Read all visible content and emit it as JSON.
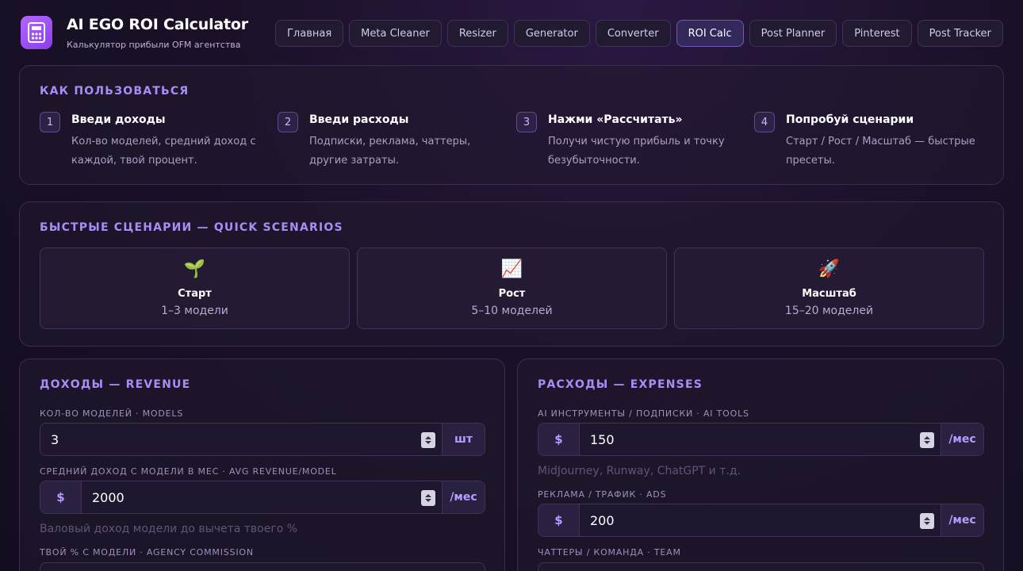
{
  "app": {
    "title": "AI EGO ROI Calculator",
    "subtitle": "Калькулятор прибыли OFM агентства",
    "logo_icon": "calculator-icon"
  },
  "nav": {
    "items": [
      {
        "label": "Главная",
        "active": false
      },
      {
        "label": "Meta Cleaner",
        "active": false
      },
      {
        "label": "Resizer",
        "active": false
      },
      {
        "label": "Generator",
        "active": false
      },
      {
        "label": "Converter",
        "active": false
      },
      {
        "label": "ROI Calc",
        "active": true
      },
      {
        "label": "Post Planner",
        "active": false
      },
      {
        "label": "Pinterest",
        "active": false
      },
      {
        "label": "Post Tracker",
        "active": false
      }
    ]
  },
  "howto": {
    "title": "КАК ПОЛЬЗОВАТЬСЯ",
    "steps": [
      {
        "num": "1",
        "title": "Введи доходы",
        "desc": "Кол-во моделей, средний доход с каждой, твой процент."
      },
      {
        "num": "2",
        "title": "Введи расходы",
        "desc": "Подписки, реклама, чаттеры, другие затраты."
      },
      {
        "num": "3",
        "title": "Нажми «Рассчитать»",
        "desc": "Получи чистую прибыль и точку безубыточности."
      },
      {
        "num": "4",
        "title": "Попробуй сценарии",
        "desc": "Старт / Рост / Масштаб — быстрые пресеты."
      }
    ]
  },
  "scenarios": {
    "title": "БЫСТРЫЕ СЦЕНАРИИ — QUICK SCENARIOS",
    "items": [
      {
        "icon": "🌱",
        "icon_name": "seedling-icon",
        "name": "Старт",
        "desc": "1–3 модели"
      },
      {
        "icon": "📈",
        "icon_name": "chart-up-icon",
        "name": "Рост",
        "desc": "5–10 моделей"
      },
      {
        "icon": "🚀",
        "icon_name": "rocket-icon",
        "name": "Масштаб",
        "desc": "15–20 моделей"
      }
    ]
  },
  "revenue": {
    "title": "ДОХОДЫ — REVENUE",
    "models_label": "КОЛ-ВО МОДЕЛЕЙ · MODELS",
    "models_value": "3",
    "models_suffix": "шт",
    "avg_label": "СРЕДНИЙ ДОХОД С МОДЕЛИ В МЕС · AVG REVENUE/MODEL",
    "avg_prefix": "$",
    "avg_value": "2000",
    "avg_suffix": "/мес",
    "avg_hint": "Валовый доход модели до вычета твоего %",
    "commission_label": "ТВОЙ % С МОДЕЛИ · AGENCY COMMISSION"
  },
  "expenses": {
    "title": "РАСХОДЫ — EXPENSES",
    "tools_label": "AI ИНСТРУМЕНТЫ / ПОДПИСКИ · AI TOOLS",
    "tools_prefix": "$",
    "tools_value": "150",
    "tools_suffix": "/мес",
    "tools_hint": "MidJourney, Runway, ChatGPT и т.д.",
    "ads_label": "РЕКЛАМА / ТРАФИК · ADS",
    "ads_prefix": "$",
    "ads_value": "200",
    "ads_suffix": "/мес",
    "team_label": "ЧАТТЕРЫ / КОМАНДА · TEAM"
  },
  "colors": {
    "accent": "#a98df7",
    "logo": "#9b4dff",
    "background": "#1a1128"
  }
}
